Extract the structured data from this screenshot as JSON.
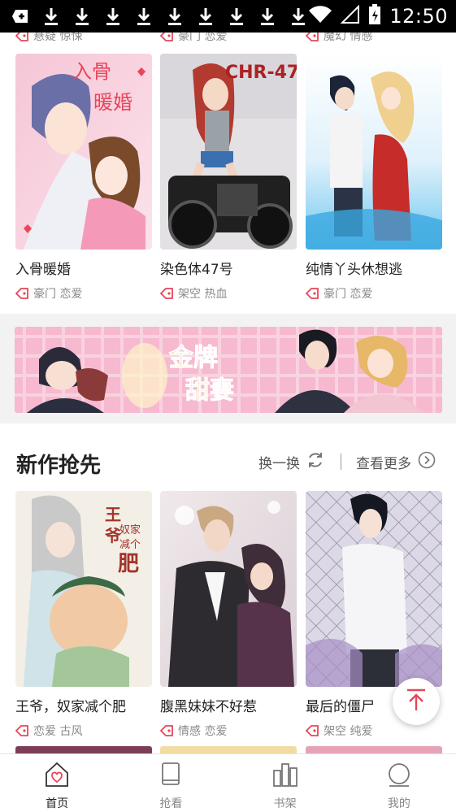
{
  "status_bar": {
    "time": "12:50",
    "notification_icons": [
      "add-icon",
      "download-icon",
      "download-icon",
      "download-icon",
      "download-icon",
      "download-icon",
      "download-icon",
      "download-icon",
      "download-icon",
      "download-icon"
    ]
  },
  "top_row_tags": [
    {
      "tags": "悬疑 惊悚"
    },
    {
      "tags": "豪门 恋爱"
    },
    {
      "tags": "魔幻 情感"
    }
  ],
  "row1": [
    {
      "title": "入骨暖婚",
      "tags": "豪门 恋爱",
      "cover_text": "入骨暖婚"
    },
    {
      "title": "染色体47号",
      "tags": "架空 热血",
      "cover_text": "CHR-47"
    },
    {
      "title": "纯情丫头休想逃",
      "tags": "豪门 恋爱",
      "cover_text": ""
    }
  ],
  "banner": {
    "text": "金牌甜妻"
  },
  "section": {
    "title": "新作抢先",
    "refresh_label": "换一换",
    "more_label": "查看更多"
  },
  "row2": [
    {
      "title": "王爷，奴家减个肥",
      "tags": "恋爱 古风",
      "cover_text": "王爷奴家减个肥"
    },
    {
      "title": "腹黑妹妹不好惹",
      "tags": "情感 恋爱",
      "cover_text": ""
    },
    {
      "title": "最后的僵尸",
      "tags": "架空 纯爱",
      "cover_text": ""
    }
  ],
  "tabbar": [
    {
      "label": "首页",
      "icon": "home-icon",
      "active": true
    },
    {
      "label": "抢看",
      "icon": "book-icon",
      "active": false
    },
    {
      "label": "书架",
      "icon": "bookshelf-icon",
      "active": false
    },
    {
      "label": "我的",
      "icon": "profile-icon",
      "active": false
    }
  ],
  "colors": {
    "accent": "#e8465a",
    "text": "#222222",
    "muted": "#888888"
  }
}
